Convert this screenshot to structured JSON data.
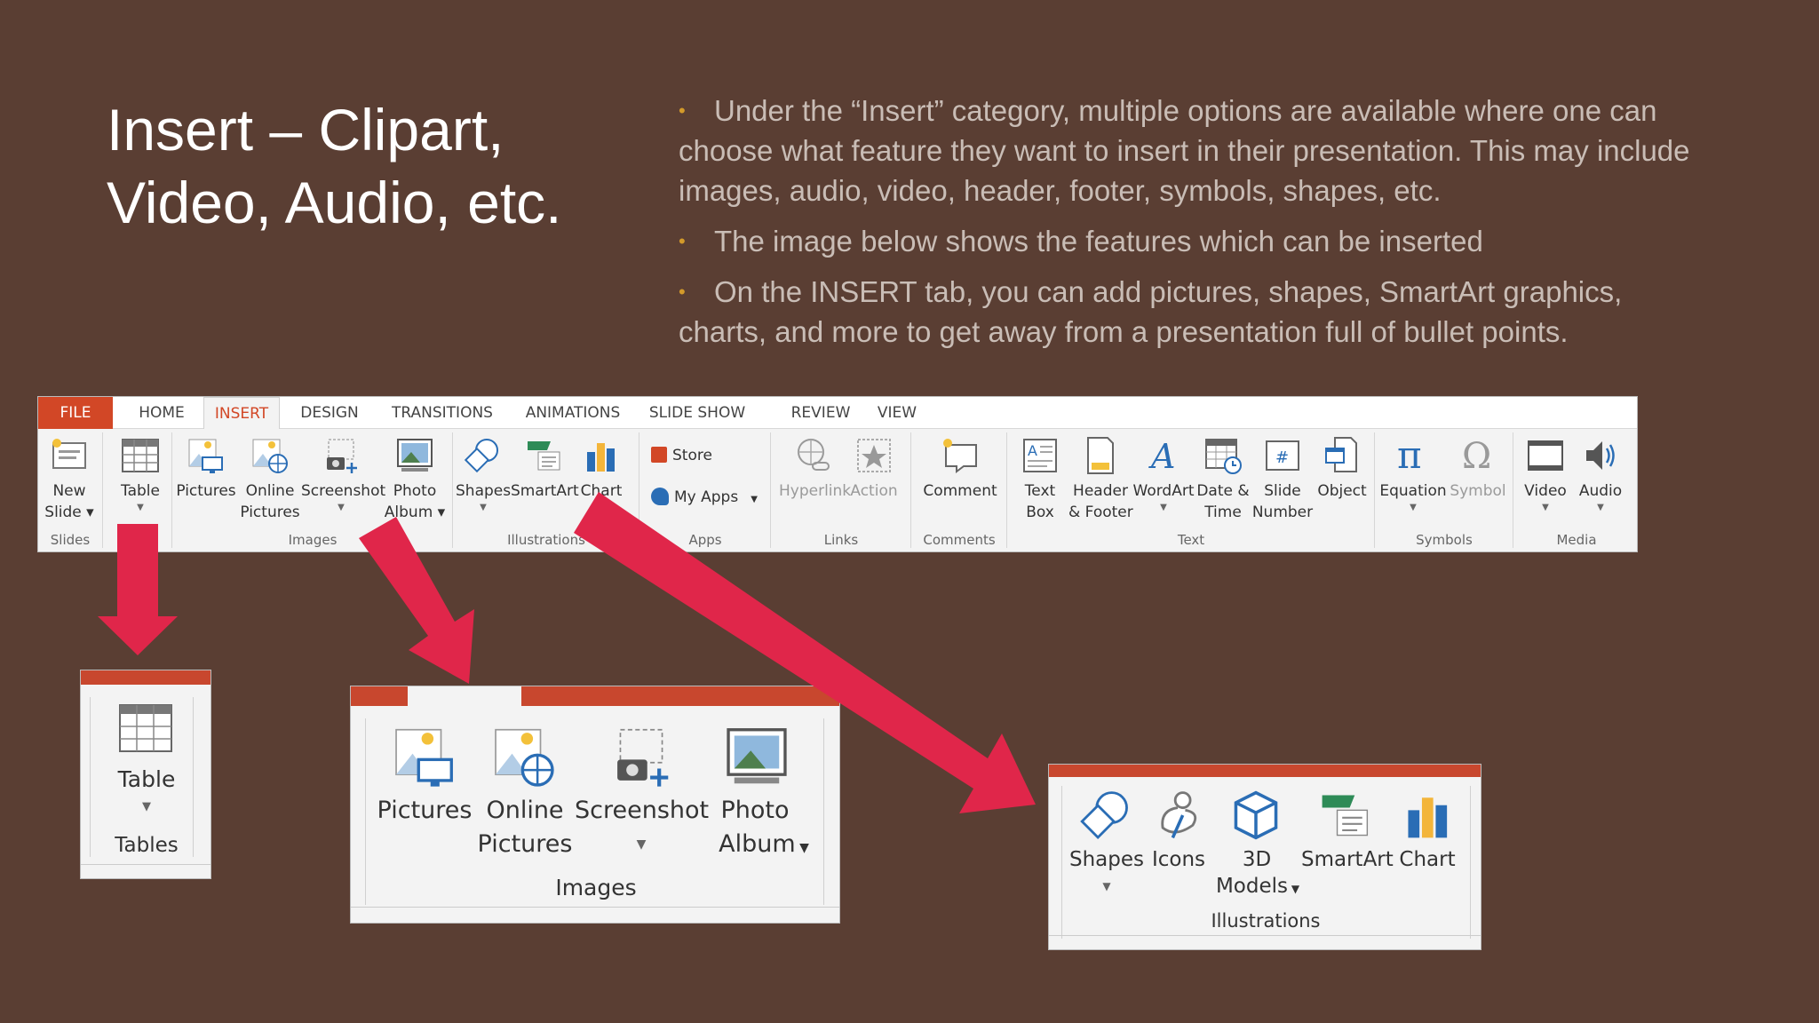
{
  "slide": {
    "title": "Insert – Clipart, Video, Audio, etc.",
    "bullets": [
      "Under the “Insert” category, multiple options are available where one can choose what feature they want to insert in their presentation. This may include images, audio, video, header, footer, symbols, shapes, etc.",
      "The image below shows the features which can be inserted",
      "On the INSERT tab, you can add pictures, shapes, SmartArt graphics, charts, and more to get away from a presentation full of bullet points."
    ]
  },
  "ribbon": {
    "tabs": [
      "FILE",
      "HOME",
      "INSERT",
      "DESIGN",
      "TRANSITIONS",
      "ANIMATIONS",
      "SLIDE SHOW",
      "REVIEW",
      "VIEW"
    ],
    "active_tab": "INSERT",
    "tools": {
      "new_slide": [
        "New",
        "Slide"
      ],
      "table": "Table",
      "pictures": "Pictures",
      "online_pictures": [
        "Online",
        "Pictures"
      ],
      "screenshot": "Screenshot",
      "photo_album": [
        "Photo",
        "Album"
      ],
      "shapes": "Shapes",
      "smartart": "SmartArt",
      "chart": "Chart",
      "store": "Store",
      "my_apps": "My Apps",
      "hyperlink": "Hyperlink",
      "action": "Action",
      "comment": "Comment",
      "text_box": [
        "Text",
        "Box"
      ],
      "header_footer": [
        "Header",
        "& Footer"
      ],
      "wordart": "WordArt",
      "date_time": [
        "Date &",
        "Time"
      ],
      "slide_number": [
        "Slide",
        "Number"
      ],
      "object": "Object",
      "equation": "Equation",
      "symbol": "Symbol",
      "video": "Video",
      "audio": "Audio"
    },
    "groups": [
      "Slides",
      "Tables",
      "Images",
      "Illustrations",
      "Apps",
      "Links",
      "Comments",
      "Text",
      "Symbols",
      "Media"
    ]
  },
  "zoom_tables": {
    "table": "Table",
    "group": "Tables"
  },
  "zoom_images": {
    "pictures": "Pictures",
    "online_pictures": [
      "Online",
      "Pictures"
    ],
    "screenshot": "Screenshot",
    "photo_album": [
      "Photo",
      "Album"
    ],
    "group": "Images"
  },
  "zoom_illustrations": {
    "shapes": "Shapes",
    "icons": "Icons",
    "models": [
      "3D",
      "Models"
    ],
    "smartart": "SmartArt",
    "chart": "Chart",
    "group": "Illustrations"
  },
  "colors": {
    "background": "#5a3e33",
    "accent": "#d24726",
    "arrow": "#e0264a",
    "bullet": "#d39a2a"
  }
}
